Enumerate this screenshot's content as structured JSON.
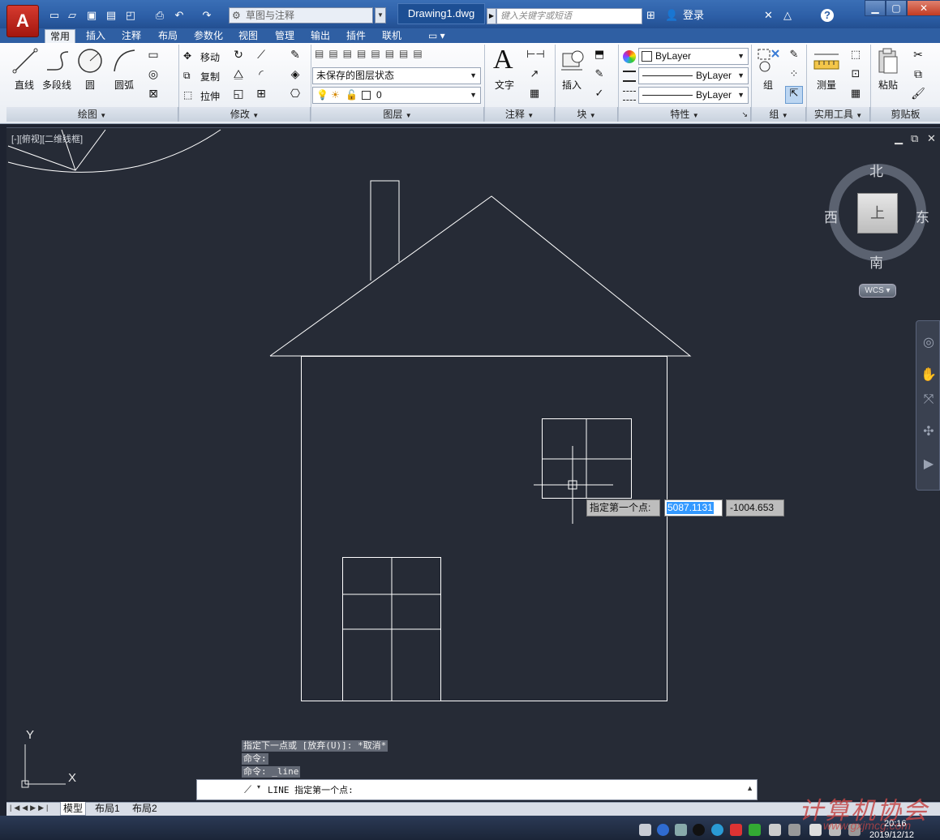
{
  "app": {
    "document_title": "Drawing1.dwg",
    "workspace": "草图与注释",
    "search_placeholder": "键入关键字或短语",
    "login_label": "登录"
  },
  "tabs": [
    "常用",
    "插入",
    "注释",
    "布局",
    "参数化",
    "视图",
    "管理",
    "输出",
    "插件",
    "联机"
  ],
  "ribbon": {
    "draw": {
      "title": "绘图",
      "line": "直线",
      "polyline": "多段线",
      "circle": "圆",
      "arc": "圆弧"
    },
    "modify": {
      "title": "修改",
      "move": "移动",
      "copy": "复制",
      "stretch": "拉伸"
    },
    "layers": {
      "title": "图层",
      "layer_state": "未保存的图层状态",
      "current_layer": "0"
    },
    "annotation": {
      "title": "注释",
      "text": "文字"
    },
    "block": {
      "title": "块",
      "insert": "插入"
    },
    "properties": {
      "title": "特性",
      "color": "ByLayer",
      "linetype": "ByLayer",
      "lineweight": "ByLayer"
    },
    "groups": {
      "title": "组",
      "group": "组"
    },
    "utilities": {
      "title": "实用工具",
      "measure": "测量"
    },
    "clipboard": {
      "title": "剪贴板",
      "paste": "粘贴"
    }
  },
  "viewport": {
    "label": "[-][俯视][二维线框]"
  },
  "viewcube": {
    "north": "北",
    "south": "南",
    "east": "东",
    "west": "西",
    "face": "上",
    "wcs": "WCS"
  },
  "dynamic_input": {
    "prompt": "指定第一个点:",
    "x_value": "5087.1131",
    "y_value": "-1004.653"
  },
  "ucs": {
    "x_label": "X",
    "y_label": "Y"
  },
  "command_history": [
    "指定下一点或 [放弃(U)]: *取消*",
    "命令:",
    "命令: _line"
  ],
  "command_line": {
    "current": "LINE 指定第一个点:"
  },
  "layout_tabs": [
    "模型",
    "布局1",
    "布局2"
  ],
  "taskbar": {
    "time": "20:16",
    "date": "2019/12/12"
  },
  "watermark": {
    "text": "计算机协会",
    "url": "www.gxjmcg.com"
  }
}
